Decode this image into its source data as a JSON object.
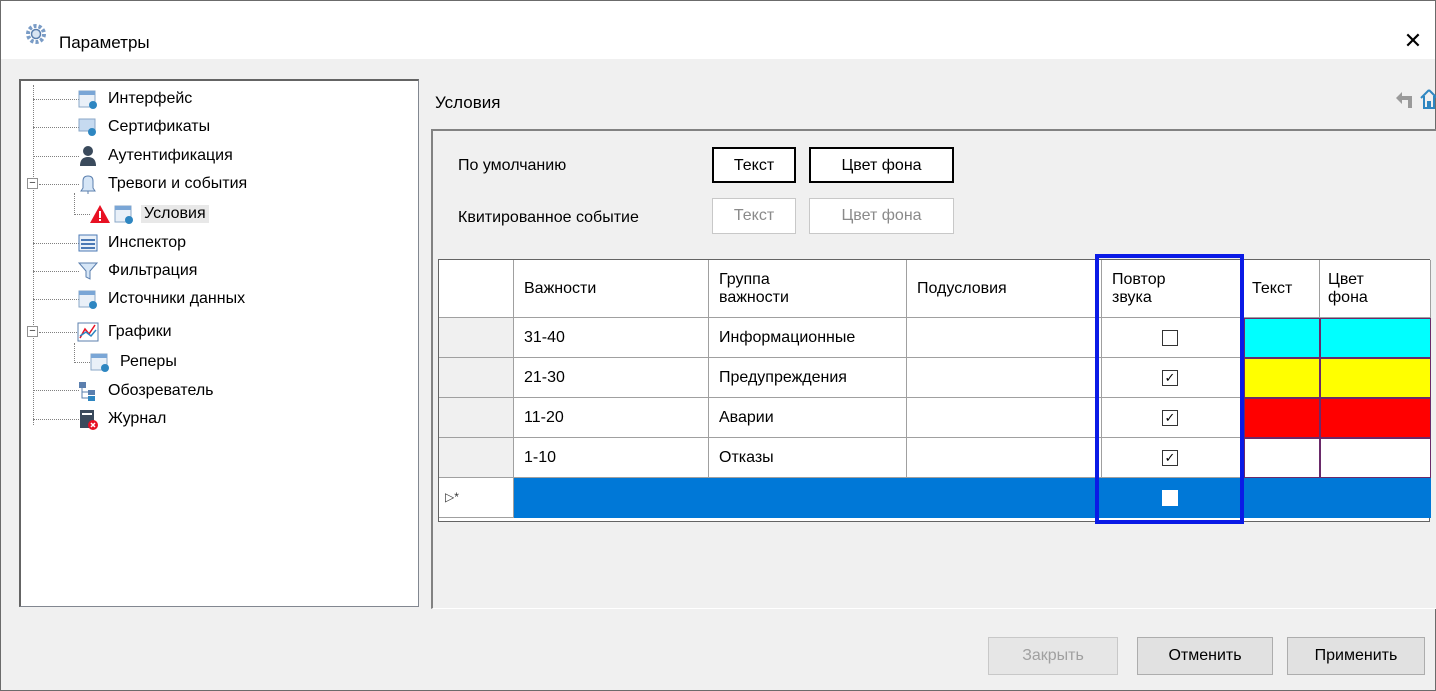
{
  "window": {
    "title": "Параметры"
  },
  "tree": {
    "items": [
      {
        "label": "Интерфейс",
        "icon": "interface-settings-icon"
      },
      {
        "label": "Сертификаты",
        "icon": "certificate-icon"
      },
      {
        "label": "Аутентификация",
        "icon": "user-icon"
      },
      {
        "label": "Тревоги и события",
        "icon": "bell-icon",
        "expanded": true
      },
      {
        "label": "Условия",
        "icon": "conditions-icon",
        "selected": true
      },
      {
        "label": "Инспектор",
        "icon": "inspector-icon"
      },
      {
        "label": "Фильтрация",
        "icon": "filter-icon"
      },
      {
        "label": "Источники данных",
        "icon": "data-sources-icon"
      },
      {
        "label": "Графики",
        "icon": "chart-icon",
        "expanded": true
      },
      {
        "label": "Реперы",
        "icon": "markers-icon"
      },
      {
        "label": "Обозреватель",
        "icon": "browser-icon"
      },
      {
        "label": "Журнал",
        "icon": "journal-icon"
      }
    ]
  },
  "panel": {
    "title": "Условия",
    "default_label": "По умолчанию",
    "ack_label": "Квитированное событие",
    "text_btn": "Текст",
    "bg_btn": "Цвет фона"
  },
  "grid": {
    "headers": {
      "severity": "Важности",
      "group": "Группа важности",
      "subconditions": "Подусловия",
      "repeat_sound": "Повтор звука",
      "text": "Текст",
      "bg": "Цвет фона"
    },
    "rows": [
      {
        "severity": "31-40",
        "group": "Информационные",
        "repeat": false,
        "text_color": "#00ffff",
        "bg_color": "#00ffff"
      },
      {
        "severity": "21-30",
        "group": "Предупреждения",
        "repeat": true,
        "text_color": "#ffff00",
        "bg_color": "#ffff00"
      },
      {
        "severity": "11-20",
        "group": "Аварии",
        "repeat": true,
        "text_color": "#ff0000",
        "bg_color": "#ff0000"
      },
      {
        "severity": "1-10",
        "group": "Отказы",
        "repeat": true,
        "text_color": "#ffffff",
        "bg_color": "#ffffff"
      }
    ],
    "new_row_selected_color": "#0078d7"
  },
  "buttons": {
    "close": "Закрыть",
    "cancel": "Отменить",
    "apply": "Применить"
  },
  "colors": {
    "highlight": "#0a1ae6",
    "selection": "#0078d7"
  }
}
